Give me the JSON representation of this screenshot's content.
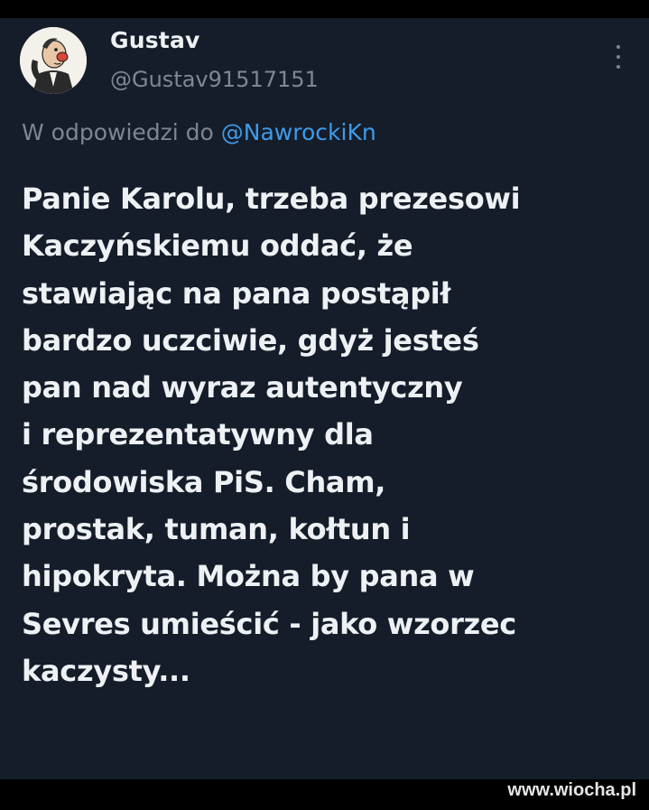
{
  "author": {
    "display_name": "Gustav",
    "handle": "@Gustav91517151",
    "avatar_icon": "cartoon-man-avatar-icon"
  },
  "menu": {
    "icon": "more-vertical-icon"
  },
  "reply": {
    "prefix": "W odpowiedzi do",
    "mention": "@NawrockiKn"
  },
  "tweet": {
    "lines": [
      "Panie Karolu, trzeba prezesowi",
      "Kaczyńskiemu oddać, że",
      "stawiając na pana postąpił",
      "bardzo uczciwie, gdyż jesteś",
      "pan nad wyraz autentyczny",
      "i reprezentatywny dla",
      "środowiska PiS. Cham,",
      "prostak, tuman, kołtun i",
      "hipokryta. Można by pana w",
      "Sevres umieścić - jako wzorzec",
      "kaczysty..."
    ]
  },
  "watermark": "www.wiocha.pl",
  "colors": {
    "background": "#151d2a",
    "text": "#eef1f4",
    "muted": "#7c8793",
    "link": "#3f9ae8"
  }
}
